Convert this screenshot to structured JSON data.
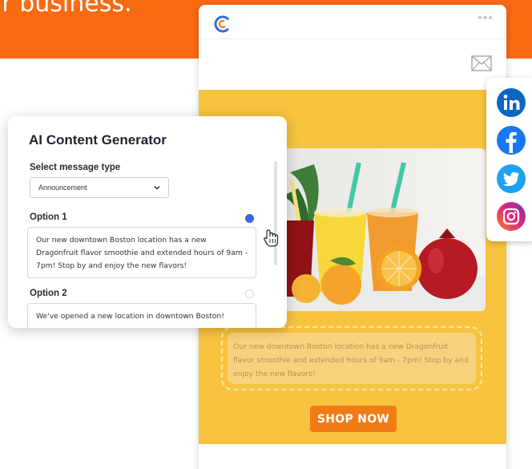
{
  "banner": {
    "text": "ir business."
  },
  "email": {
    "menu_dots": "•••",
    "body_text": "Our new downtown Boston location has a new Dragonfruit flavor smoothie and extended hours of 9am - 7pm! Stop by and enjoy the new flavors!",
    "cta_label": "SHOP NOW"
  },
  "social": {
    "items": [
      "linkedin",
      "facebook",
      "twitter",
      "instagram"
    ]
  },
  "ai_generator": {
    "title": "AI Content Generator",
    "select_label": "Select message type",
    "select_value": "Announcement",
    "option1_label": "Option 1",
    "option1_text": "Our new downtown Boston location has a new Dragonfruit flavor smoothie and extended hours of 9am - 7pm! Stop by and enjoy the new flavors!",
    "option2_label": "Option 2",
    "option2_text": "We've opened a new location in downtown Boston!",
    "selected_option": 1
  },
  "colors": {
    "banner": "#f96a12",
    "email_background": "#f7c33e",
    "cta": "#f07c17",
    "radio_selected": "#3b64df",
    "linkedin": "#0a66c2",
    "facebook": "#1877f2",
    "twitter": "#1da1f2",
    "instagram": "#c13584"
  }
}
